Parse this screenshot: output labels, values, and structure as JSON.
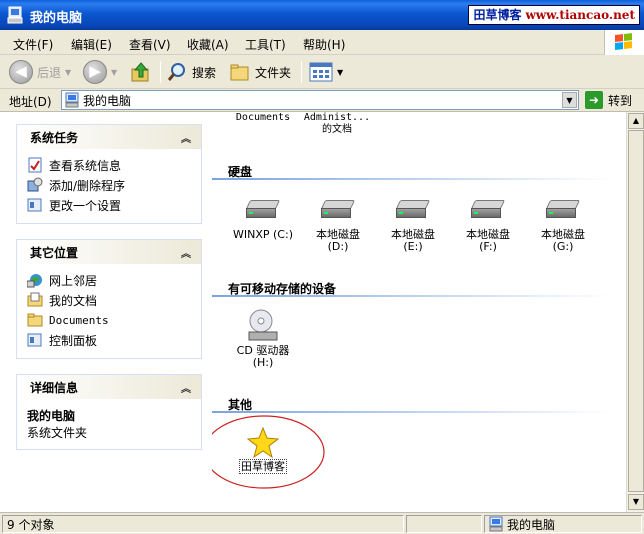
{
  "title": "我的电脑",
  "watermark": {
    "name": "田草博客",
    "url": "www.tiancao.net"
  },
  "menu": [
    "文件(F)",
    "编辑(E)",
    "查看(V)",
    "收藏(A)",
    "工具(T)",
    "帮助(H)"
  ],
  "toolbar": {
    "back": "后退",
    "search": "搜索",
    "folders": "文件夹"
  },
  "address": {
    "label": "地址(D)",
    "value": "我的电脑",
    "go": "转到"
  },
  "panels": {
    "system_tasks": {
      "title": "系统任务",
      "items": [
        "查看系统信息",
        "添加/删除程序",
        "更改一个设置"
      ]
    },
    "other_places": {
      "title": "其它位置",
      "items": [
        "网上邻居",
        "我的文档",
        "Documents",
        "控制面板"
      ]
    },
    "details": {
      "title": "详细信息",
      "name": "我的电脑",
      "desc": "系统文件夹"
    }
  },
  "top_items": [
    "Documents",
    "Administ...",
    "的文档"
  ],
  "groups": {
    "hdd": {
      "title": "硬盘",
      "drives": [
        "WINXP (C:)",
        "本地磁盘",
        "(D:)",
        "本地磁盘",
        "(E:)",
        "本地磁盘",
        "(F:)",
        "本地磁盘",
        "(G:)"
      ]
    },
    "removable": {
      "title": "有可移动存储的设备",
      "cd": "CD 驱动器",
      "cd_letter": "(H:)"
    },
    "other": {
      "title": "其他",
      "item": "田草博客"
    }
  },
  "status": {
    "count": "9 个对象",
    "location": "我的电脑"
  },
  "colors": {
    "title_bar": "#0b57d0",
    "panel_border": "#d6dff5",
    "group_rule": "#7aa3df",
    "highlight_circle": "#cc2222"
  }
}
